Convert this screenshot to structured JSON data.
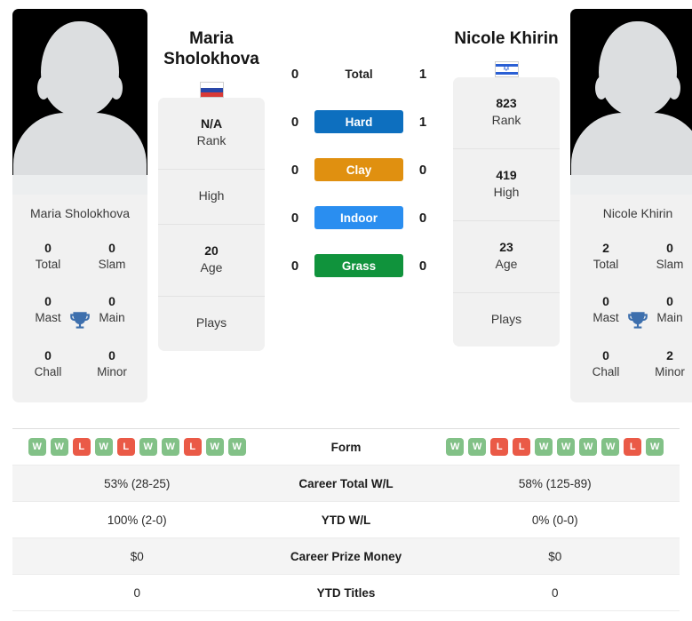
{
  "players": {
    "left": {
      "name": "Maria Sholokhova",
      "name_line1": "Maria",
      "name_line2": "Sholokhova",
      "flag": "ru-flag-icon",
      "rank_value": "N/A",
      "rank_label": "Rank",
      "high_value": "",
      "high_label": "High",
      "age_value": "20",
      "age_label": "Age",
      "plays_value": "",
      "plays_label": "Plays",
      "titles": [
        {
          "value": "0",
          "label": "Total"
        },
        {
          "value": "0",
          "label": "Slam"
        },
        {
          "value": "0",
          "label": "Mast"
        },
        {
          "value": "0",
          "label": "Main"
        },
        {
          "value": "0",
          "label": "Chall"
        },
        {
          "value": "0",
          "label": "Minor"
        }
      ],
      "form": [
        "W",
        "W",
        "L",
        "W",
        "L",
        "W",
        "W",
        "L",
        "W",
        "W"
      ]
    },
    "right": {
      "name": "Nicole Khirin",
      "name_line1": "Nicole Khirin",
      "name_line2": "",
      "flag": "il-flag-icon",
      "rank_value": "823",
      "rank_label": "Rank",
      "high_value": "419",
      "high_label": "High",
      "age_value": "23",
      "age_label": "Age",
      "plays_value": "",
      "plays_label": "Plays",
      "titles": [
        {
          "value": "2",
          "label": "Total"
        },
        {
          "value": "0",
          "label": "Slam"
        },
        {
          "value": "0",
          "label": "Mast"
        },
        {
          "value": "0",
          "label": "Main"
        },
        {
          "value": "0",
          "label": "Chall"
        },
        {
          "value": "2",
          "label": "Minor"
        }
      ],
      "form": [
        "W",
        "W",
        "L",
        "L",
        "W",
        "W",
        "W",
        "W",
        "L",
        "W"
      ]
    }
  },
  "head_to_head": [
    {
      "label": "Total",
      "left": "0",
      "right": "1",
      "style": "plain",
      "color": ""
    },
    {
      "label": "Hard",
      "left": "0",
      "right": "1",
      "style": "bar",
      "color": "#0d6fbf"
    },
    {
      "label": "Clay",
      "left": "0",
      "right": "0",
      "style": "bar",
      "color": "#e09010"
    },
    {
      "label": "Indoor",
      "left": "0",
      "right": "0",
      "style": "bar",
      "color": "#2a8ef0"
    },
    {
      "label": "Grass",
      "left": "0",
      "right": "0",
      "style": "bar",
      "color": "#10933c"
    }
  ],
  "stats_table": [
    {
      "label": "Form",
      "left": "",
      "right": "",
      "type": "form"
    },
    {
      "label": "Career Total W/L",
      "left": "53% (28-25)",
      "right": "58% (125-89)",
      "type": "text"
    },
    {
      "label": "YTD W/L",
      "left": "100% (2-0)",
      "right": "0% (0-0)",
      "type": "text"
    },
    {
      "label": "Career Prize Money",
      "left": "$0",
      "right": "$0",
      "type": "text"
    },
    {
      "label": "YTD Titles",
      "left": "0",
      "right": "0",
      "type": "text"
    }
  ],
  "colors": {
    "win_badge": "#82c187",
    "loss_badge": "#ea5a47",
    "trophy": "#3d6fad",
    "card_bg": "#f1f1f1"
  }
}
